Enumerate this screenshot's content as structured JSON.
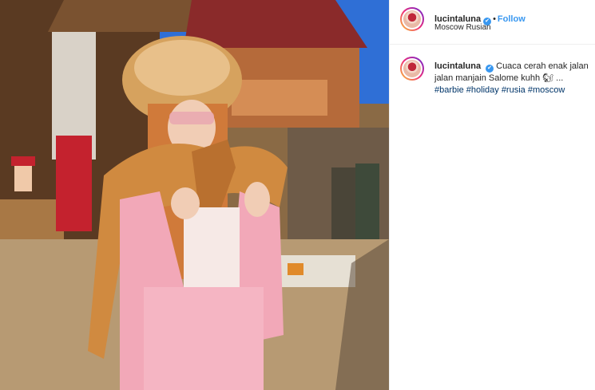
{
  "post": {
    "username": "lucintaluna",
    "verified_mark": "✔",
    "dot": "•",
    "follow_label": "Follow",
    "location": "Moscow Rusian"
  },
  "caption": {
    "username": "lucintaluna",
    "text": "Cuaca cerah enak jalan jalan manjain Salome kuhh 🐿 ...",
    "hashtags": [
      "#barbie",
      "#holiday",
      "#rusia",
      "#moscow"
    ]
  },
  "icons": {
    "verified": "verified-badge-icon",
    "avatar": "profile-avatar"
  },
  "colors": {
    "link_blue": "#3897f0",
    "hashtag": "#003569",
    "text": "#262626",
    "border": "#efefef"
  }
}
